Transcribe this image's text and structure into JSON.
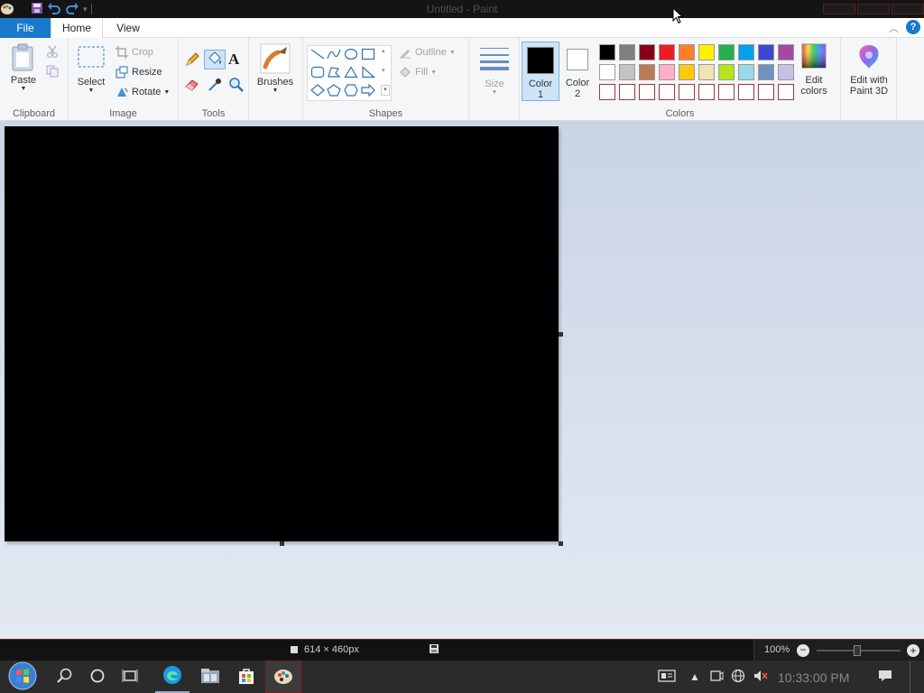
{
  "window": {
    "title": "Untitled - Paint"
  },
  "tabs": [
    {
      "label": "File"
    },
    {
      "label": "Home"
    },
    {
      "label": "View"
    }
  ],
  "ribbon": {
    "clipboard": {
      "paste_label": "Paste",
      "group_label": "Clipboard"
    },
    "image": {
      "select_label": "Select",
      "crop_label": "Crop",
      "resize_label": "Resize",
      "rotate_label": "Rotate",
      "group_label": "Image"
    },
    "tools": {
      "group_label": "Tools"
    },
    "brushes": {
      "label": "Brushes"
    },
    "shapes": {
      "outline_label": "Outline",
      "fill_label": "Fill",
      "group_label": "Shapes"
    },
    "size": {
      "label": "Size"
    },
    "colors": {
      "color1_label": "Color",
      "color1_num": "1",
      "color2_label": "Color",
      "color2_num": "2",
      "color1_value": "#000000",
      "color2_value": "#ffffff",
      "edit_colors_line1": "Edit",
      "edit_colors_line2": "colors",
      "paint3d_line1": "Edit with",
      "paint3d_line2": "Paint 3D",
      "group_label": "Colors",
      "row1": [
        "#000000",
        "#7f7f7f",
        "#880015",
        "#ed1c24",
        "#ff7f27",
        "#fff200",
        "#22b14c",
        "#00a2e8",
        "#3f48cc",
        "#a349a4"
      ],
      "row2": [
        "#ffffff",
        "#c3c3c3",
        "#b97a57",
        "#ffaec9",
        "#ffc90e",
        "#efe4b0",
        "#b5e61d",
        "#99d9ea",
        "#7092be",
        "#c8bfe7"
      ]
    }
  },
  "canvas": {
    "color": "#000000"
  },
  "statusbar": {
    "dimensions": "614 × 460px",
    "zoom": "100%"
  },
  "taskbar": {
    "clock": "10:33:00 PM"
  }
}
